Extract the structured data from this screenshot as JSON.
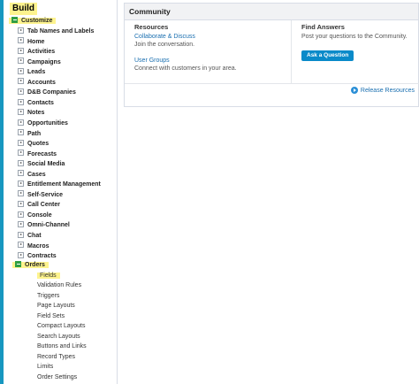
{
  "sidebar": {
    "build_title": "Build",
    "customize_label": "Customize",
    "customize_items": [
      "Tab Names and Labels",
      "Home",
      "Activities",
      "Campaigns",
      "Leads",
      "Accounts",
      "D&B Companies",
      "Contacts",
      "Notes",
      "Opportunities",
      "Path",
      "Quotes",
      "Forecasts",
      "Social Media",
      "Cases",
      "Entitlement Management",
      "Self-Service",
      "Call Center",
      "Console",
      "Omni-Channel",
      "Chat",
      "Macros",
      "Contracts"
    ],
    "orders_label": "Orders",
    "orders_children": [
      "Fields",
      "Validation Rules",
      "Triggers",
      "Page Layouts",
      "Field Sets",
      "Compact Layouts",
      "Search Layouts",
      "Buttons and Links",
      "Record Types",
      "Limits",
      "Order Settings"
    ]
  },
  "community": {
    "title": "Community",
    "resources_title": "Resources",
    "collab_link": "Collaborate & Discuss",
    "collab_sub": "Join the conversation.",
    "groups_link": "User Groups",
    "groups_sub": "Connect with customers in your area.",
    "find_title": "Find Answers",
    "find_sub": "Post your questions to the Community.",
    "ask_button": "Ask a Question",
    "release_link": "Release Resources"
  },
  "colors": {
    "accent_bar": "#1797c0",
    "highlight": "#fdf38e",
    "link": "#1a6fb0",
    "button": "#0a8ac9"
  }
}
